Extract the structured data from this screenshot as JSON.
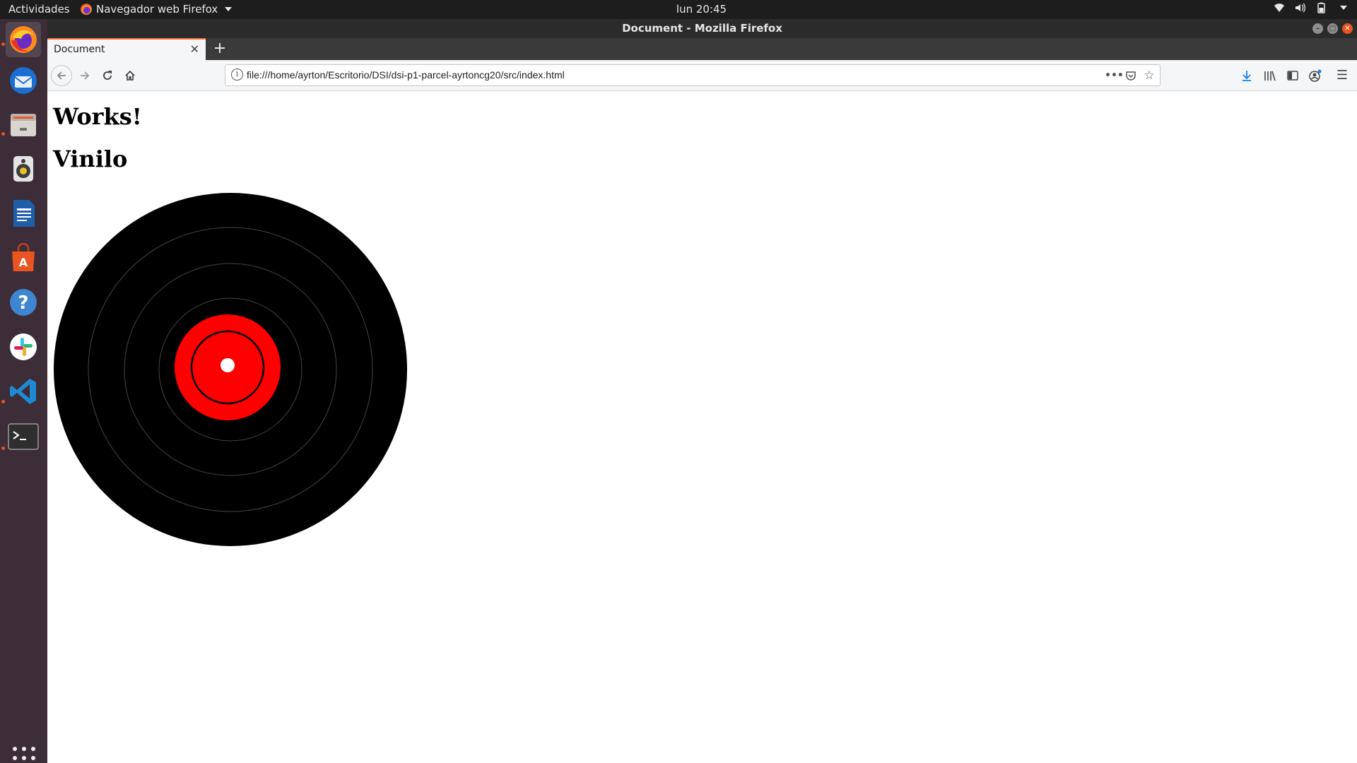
{
  "topbar": {
    "activities": "Actividades",
    "app_name": "Navegador web Firefox",
    "clock": "lun 20:45"
  },
  "window": {
    "title": "Document - Mozilla Firefox"
  },
  "tabs": [
    {
      "label": "Document"
    }
  ],
  "urlbar": {
    "url": "file:///home/ayrton/Escritorio/DSI/dsi-p1-parcel-ayrtoncg20/src/index.html"
  },
  "page": {
    "heading_1": "Works!",
    "heading_2": "Vinilo",
    "vinyl_colors": {
      "disc": "#000000",
      "label": "#ff0000",
      "hole": "#ffffff",
      "grooves": "#444444"
    }
  },
  "dock": {
    "items": [
      "firefox-icon",
      "thunderbird-icon",
      "files-icon",
      "rhythmbox-icon",
      "writer-icon",
      "software-icon",
      "help-icon",
      "slack-icon",
      "vscode-icon",
      "terminal-icon"
    ]
  },
  "accent": "#e95420"
}
